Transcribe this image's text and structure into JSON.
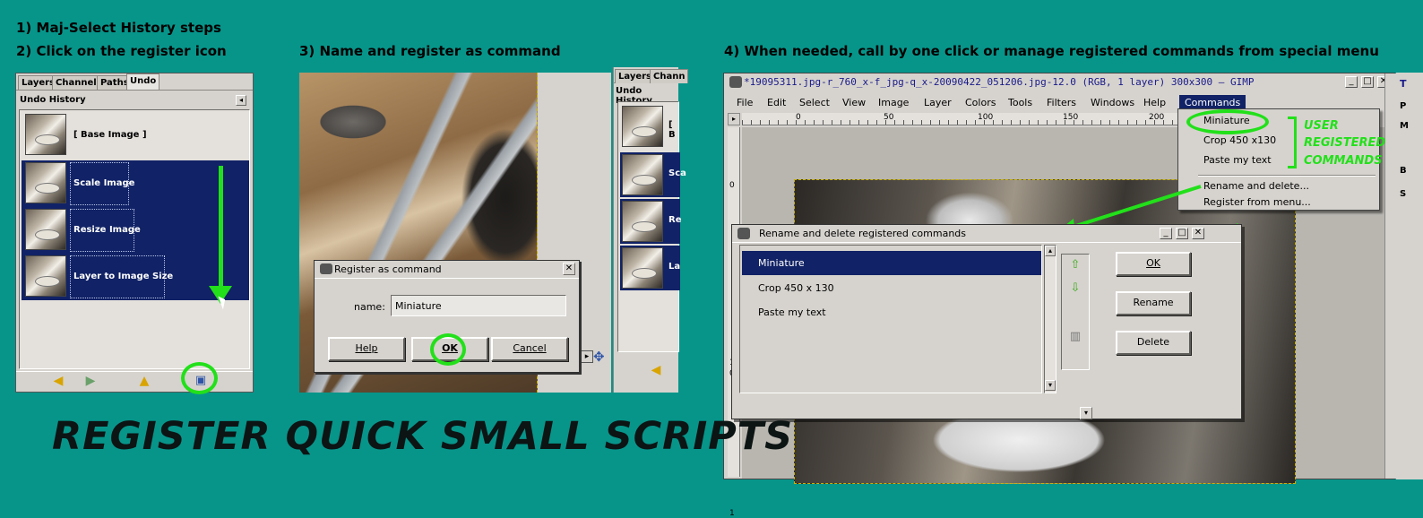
{
  "steps": {
    "s1": "1) Maj-Select History steps",
    "s2": "2) Click on the register icon",
    "s3": "3) Name and register as command",
    "s4": "4) When needed, call by one click or manage registered commands from special menu"
  },
  "headline": "REGISTER QUICK SMALL SCRIPTS",
  "panel1": {
    "tabs": [
      "Layers",
      "Channels",
      "Paths",
      "Undo"
    ],
    "title": "Undo History",
    "items": [
      "[ Base Image ]",
      "Scale Image",
      "Resize Image",
      "Layer to Image Size"
    ]
  },
  "register_dialog": {
    "title": "Register as command",
    "name_label": "name:",
    "name_value": "Miniature",
    "help": "Help",
    "ok": "OK",
    "cancel": "Cancel"
  },
  "panel3": {
    "tabs": [
      "Layers",
      "Chann"
    ],
    "title": "Undo History",
    "items": [
      "[ B",
      "Sca",
      "Re",
      "La"
    ]
  },
  "gimp": {
    "title": "*19095311.jpg-r_760_x-f_jpg-q_x-20090422_051206.jpg-12.0 (RGB, 1 layer) 300x300 – GIMP",
    "menu": [
      "File",
      "Edit",
      "Select",
      "View",
      "Image",
      "Layer",
      "Colors",
      "Tools",
      "Filters",
      "Windows",
      "Help",
      "Commands"
    ],
    "ruler_ticks": [
      "0",
      "50",
      "100",
      "150",
      "200"
    ],
    "vruler_ticks": [
      "0",
      "1",
      "0",
      "1"
    ],
    "commands_menu": {
      "registered": [
        "Miniature",
        "Crop 450 x130",
        "Paste my text"
      ],
      "manage": [
        "Rename and delete...",
        "Register from menu..."
      ]
    },
    "annotation": [
      "USER",
      "REGISTERED",
      "COMMANDS"
    ],
    "side_labels": [
      "T",
      "P",
      "M",
      "B",
      "S"
    ]
  },
  "rename_dialog": {
    "title": "Rename and delete registered commands",
    "items": [
      "Miniature",
      "Crop 450 x 130",
      "Paste my text"
    ],
    "ok": "OK",
    "rename": "Rename",
    "delete": "Delete"
  },
  "colors": {
    "background": "#07958a",
    "selection": "#112266",
    "annotation_green": "#22e01a"
  }
}
